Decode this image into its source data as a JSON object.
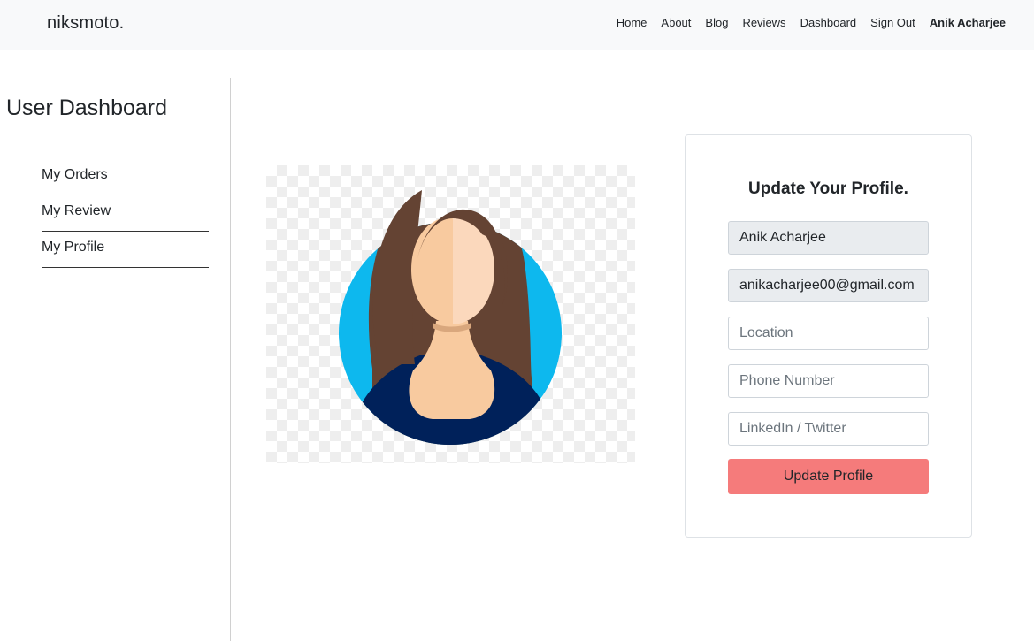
{
  "navbar": {
    "brand": "niksmoto.",
    "links": [
      "Home",
      "About",
      "Blog",
      "Reviews",
      "Dashboard",
      "Sign Out"
    ],
    "user_name": "Anik Acharjee"
  },
  "sidebar": {
    "title": "User Dashboard",
    "items": [
      "My Orders",
      "My Review",
      "My Profile"
    ]
  },
  "avatar": {
    "icon": "avatar-woman-illustration",
    "colors": {
      "circle": "#0db8ee",
      "hair": "#644333",
      "skin": "#f8ca9f",
      "skin_light": "#fbd8bc",
      "shirt": "#00215a"
    }
  },
  "profile_form": {
    "title": "Update Your Profile.",
    "name_value": "Anik Acharjee",
    "email_value": "anikacharjee00@gmail.com",
    "location_placeholder": "Location",
    "phone_placeholder": "Phone Number",
    "social_placeholder": "LinkedIn / Twitter",
    "submit_label": "Update Profile",
    "button_color": "#f57b7b"
  }
}
